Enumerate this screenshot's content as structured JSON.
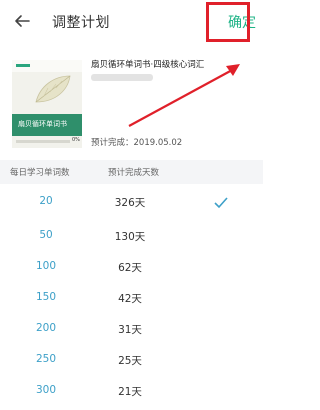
{
  "header": {
    "back_icon": "arrow-left-icon",
    "title": "调整计划",
    "confirm_label": "确定"
  },
  "book": {
    "name": "扇贝循环单词书·四级核心词汇",
    "finish_label": "预计完成：2019.05.02",
    "cover": {
      "band_title": "扇贝循环单词书",
      "progress_label": "0%",
      "progress": 0
    }
  },
  "table": {
    "header": [
      "每日学习单词数",
      "预计完成天数"
    ],
    "rows": [
      {
        "words": "20",
        "days": "326天",
        "selected": true
      },
      {
        "words": "50",
        "days": "130天",
        "selected": false
      },
      {
        "words": "100",
        "days": "62天",
        "selected": false
      },
      {
        "words": "150",
        "days": "42天",
        "selected": false
      },
      {
        "words": "200",
        "days": "31天",
        "selected": false
      },
      {
        "words": "250",
        "days": "25天",
        "selected": false
      },
      {
        "words": "300",
        "days": "21天",
        "selected": false
      }
    ]
  },
  "colors": {
    "accent": "#1db386",
    "word_count": "#3da0c8",
    "highlight_red": "#e0202a",
    "cover_green": "#2f8f6b"
  }
}
